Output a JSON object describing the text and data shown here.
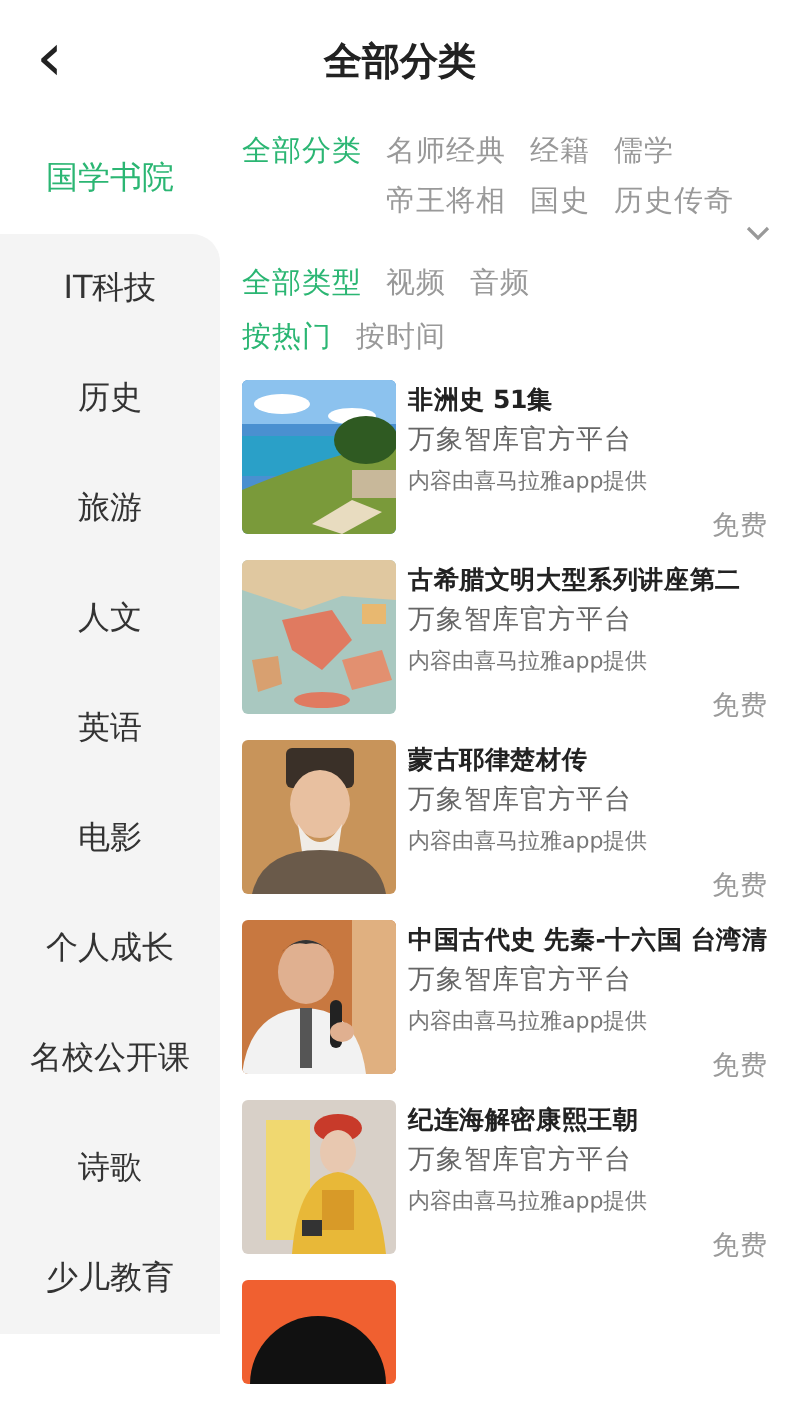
{
  "header": {
    "back_icon": "‹",
    "title": "全部分类"
  },
  "sidebar": {
    "items": [
      {
        "label": "国学书院",
        "selected": true
      },
      {
        "label": "IT科技",
        "selected": false
      },
      {
        "label": "历史",
        "selected": false
      },
      {
        "label": "旅游",
        "selected": false
      },
      {
        "label": "人文",
        "selected": false
      },
      {
        "label": "英语",
        "selected": false
      },
      {
        "label": "电影",
        "selected": false
      },
      {
        "label": "个人成长",
        "selected": false
      },
      {
        "label": "名校公开课",
        "selected": false
      },
      {
        "label": "诗歌",
        "selected": false
      },
      {
        "label": "少儿教育",
        "selected": false
      }
    ]
  },
  "filters": {
    "categories": [
      {
        "label": "全部分类",
        "selected": true
      },
      {
        "label": "名师经典",
        "selected": false
      },
      {
        "label": "经籍",
        "selected": false
      },
      {
        "label": "儒学",
        "selected": false
      },
      {
        "label": "帝王将相",
        "selected": false
      },
      {
        "label": "国史",
        "selected": false
      },
      {
        "label": "历史传奇",
        "selected": false
      }
    ],
    "expanded": false,
    "types": [
      {
        "label": "全部类型",
        "selected": true
      },
      {
        "label": "视频",
        "selected": false
      },
      {
        "label": "音频",
        "selected": false
      }
    ],
    "sorts": [
      {
        "label": "按热门",
        "selected": true
      },
      {
        "label": "按时间",
        "selected": false
      }
    ]
  },
  "items": [
    {
      "title": "非洲史 51集",
      "publisher": "万象智库官方平台",
      "source": "内容由喜马拉雅app提供",
      "price": "免费"
    },
    {
      "title": "古希腊文明大型系列讲座第二",
      "publisher": "万象智库官方平台",
      "source": "内容由喜马拉雅app提供",
      "price": "免费"
    },
    {
      "title": "蒙古耶律楚材传",
      "publisher": "万象智库官方平台",
      "source": "内容由喜马拉雅app提供",
      "price": "免费"
    },
    {
      "title": "中国古代史 先秦-十六国 台湾清",
      "publisher": "万象智库官方平台",
      "source": "内容由喜马拉雅app提供",
      "price": "免费"
    },
    {
      "title": "纪连海解密康熙王朝",
      "publisher": "万象智库官方平台",
      "source": "内容由喜马拉雅app提供",
      "price": "免费"
    }
  ]
}
